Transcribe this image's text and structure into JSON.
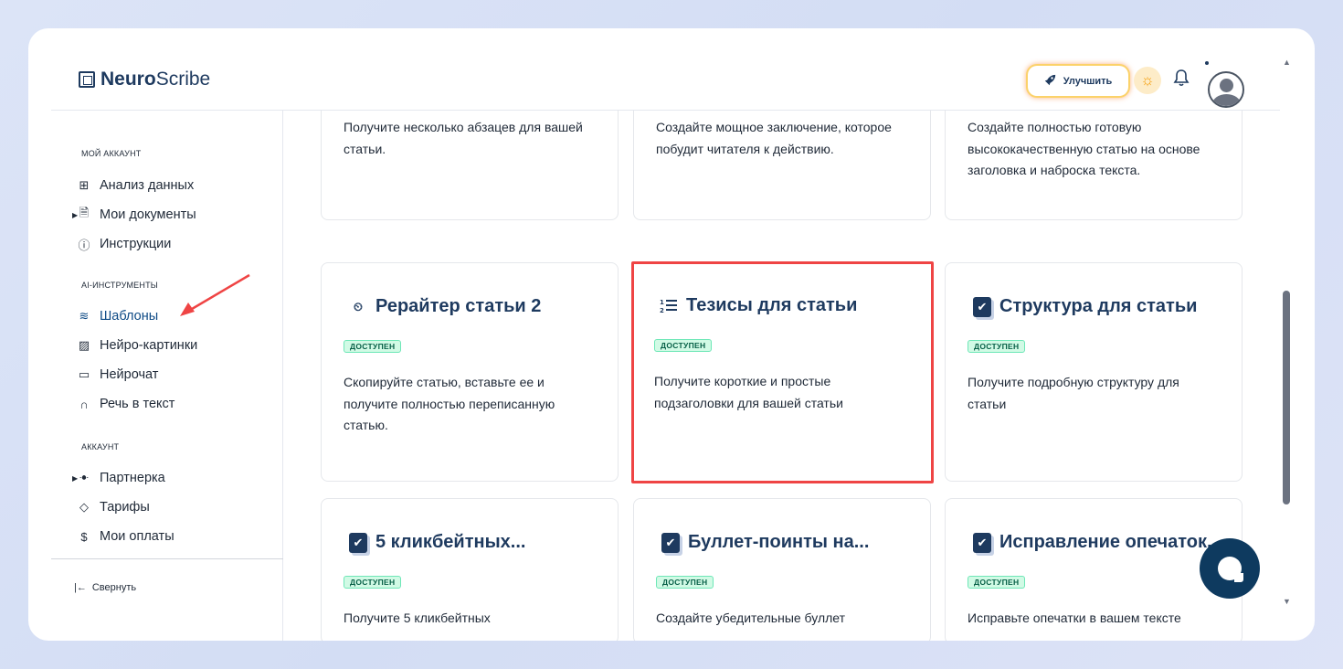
{
  "app": {
    "logo_bold": "Neuro",
    "logo_regular": "Scribe"
  },
  "header": {
    "upgrade_label": "Улучшить"
  },
  "sidebar": {
    "section_my_account": "МОЙ АККАУНТ",
    "items_account": [
      {
        "label": "Анализ данных",
        "icon": "grid-icon"
      },
      {
        "label": "Мои документы",
        "icon": "document-icon"
      },
      {
        "label": "Инструкции",
        "icon": "help-circle-icon"
      }
    ],
    "section_ai_tools": "AI-ИНСТРУМЕНТЫ",
    "items_ai": [
      {
        "label": "Шаблоны",
        "icon": "layers-icon",
        "active": true
      },
      {
        "label": "Нейро-картинки",
        "icon": "image-icon"
      },
      {
        "label": "Нейрочат",
        "icon": "chat-icon"
      },
      {
        "label": "Речь в текст",
        "icon": "headphones-icon"
      }
    ],
    "section_account": "АККАУНТ",
    "items_billing": [
      {
        "label": "Партнерка",
        "icon": "users-icon"
      },
      {
        "label": "Тарифы",
        "icon": "tag-icon"
      },
      {
        "label": "Мои оплаты",
        "icon": "dollar-icon"
      }
    ],
    "collapse_label": "Свернуть"
  },
  "cards": {
    "top": [
      {
        "description": "Получите несколько абзацев для вашей статьи."
      },
      {
        "description": "Создайте мощное заключение, которое побудит читателя к действию."
      },
      {
        "description": "Создайте полностью готовую высококачественную статью на основе заголовка и наброска текста."
      }
    ],
    "middle": [
      {
        "title": "Рерайтер статьи 2",
        "badge": "ДОСТУПЕН",
        "description": "Скопируйте статью, вставьте ее и получите полностью переписанную статью.",
        "icon": "clock-icon"
      },
      {
        "title": "Тезисы для статьи",
        "badge": "ДОСТУПЕН",
        "description": "Получите короткие и простые подзаголовки для вашей статьи",
        "icon": "numbered-list-icon"
      },
      {
        "title": "Структура для статьи",
        "badge": "ДОСТУПЕН",
        "description": "Получите подробную структуру для статьи",
        "icon": "checkbox-icon"
      }
    ],
    "bottom": [
      {
        "title": "5 кликбейтных...",
        "badge": "ДОСТУПЕН",
        "description": "Получите 5 кликбейтных",
        "icon": "checkbox-icon"
      },
      {
        "title": "Буллет-поинты на...",
        "badge": "ДОСТУПЕН",
        "description": "Создайте убедительные буллет",
        "icon": "checkbox-icon"
      },
      {
        "title": "Исправление опечаток...",
        "badge": "ДОСТУПЕН",
        "description": "Исправьте опечатки в вашем тексте",
        "icon": "checkbox-icon"
      }
    ]
  },
  "colors": {
    "accent": "#1e3a5f",
    "highlight": "#ef4444",
    "badge_bg": "#d1fae5"
  }
}
